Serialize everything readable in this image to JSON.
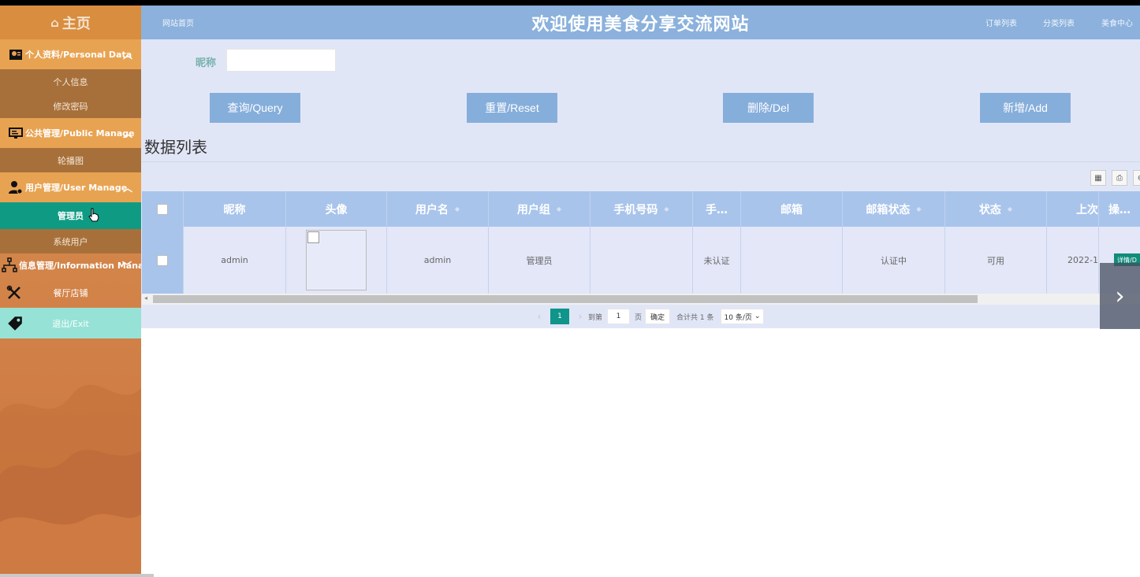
{
  "sidebar": {
    "home": "主页",
    "groups": [
      {
        "label": "个人资料/Personal Data",
        "items": [
          "个人信息",
          "修改密码"
        ]
      },
      {
        "label": "公共管理/Public Manage",
        "items": [
          "轮播图"
        ]
      },
      {
        "label": "用户管理/User Manage",
        "items": [
          "管理员",
          "系统用户"
        ],
        "active": "管理员"
      },
      {
        "label": "信息管理/Information Manage"
      }
    ],
    "restaurant": "餐厅店铺",
    "exit": "退出/Exit"
  },
  "header": {
    "home_link": "网站首页",
    "title": "欢迎使用美食分享交流网站",
    "links": [
      "订单列表",
      "分类列表",
      "美食中心"
    ]
  },
  "search": {
    "label": "昵称",
    "value": "",
    "buttons": [
      "查询/Query",
      "重置/Reset",
      "删除/Del",
      "新增/Add"
    ]
  },
  "section_title": "数据列表",
  "table": {
    "columns": [
      "昵称",
      "头像",
      "用户名",
      "用户组",
      "手机号码",
      "手…",
      "邮箱",
      "邮箱状态",
      "状态",
      "上次",
      "操…"
    ],
    "rows": [
      {
        "nickname": "admin",
        "username": "admin",
        "group": "管理员",
        "phone": "",
        "phone_status": "未认证",
        "email": "",
        "email_status": "认证中",
        "status": "可用",
        "last": "2022-1",
        "op": "详情/D"
      }
    ]
  },
  "pager": {
    "current": "1",
    "goto_label": "到第",
    "goto_value": "1",
    "page_unit": "页",
    "confirm": "确定",
    "total": "合计共 1 条",
    "page_size": "10 条/页"
  },
  "colors": {
    "sidebar": "#d98d3f",
    "header": "#8bb1dc",
    "button": "#86aedb",
    "active": "#0f9b83"
  }
}
